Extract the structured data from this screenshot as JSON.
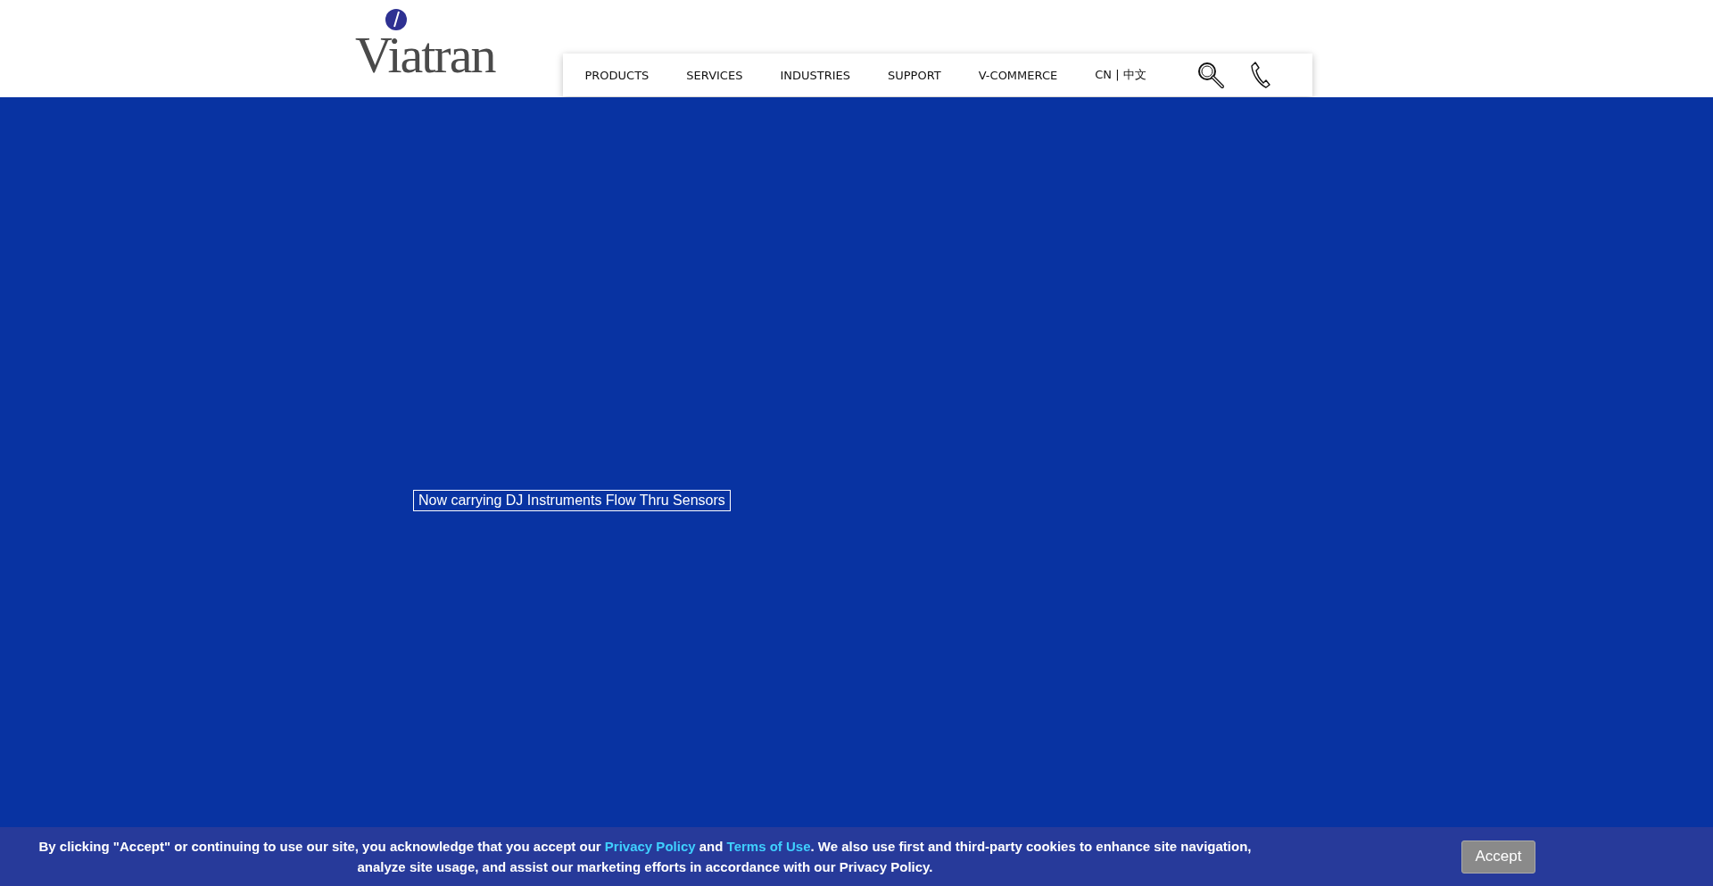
{
  "logo": {
    "text": "Viatran"
  },
  "nav": {
    "items": [
      {
        "label": "PRODUCTS"
      },
      {
        "label": "SERVICES"
      },
      {
        "label": "INDUSTRIES"
      },
      {
        "label": "SUPPORT"
      },
      {
        "label": "V-COMMERCE"
      },
      {
        "label": "CN | 中文"
      }
    ]
  },
  "hero": {
    "headline": "Now carrying DJ Instruments Flow Thru Sensors"
  },
  "cookie_banner": {
    "text": "By clicking \"Accept\" or continuing to use our site, you acknowledge that you accept our ",
    "links": [
      "Privacy Policy",
      "Terms of Use"
    ],
    "joiner": " and ",
    "text_end": ". We also use first and third-party cookies to enhance site navigation, analyze site usage, and assist our marketing efforts in accordance with our Privacy Policy.",
    "button": "Accept"
  }
}
